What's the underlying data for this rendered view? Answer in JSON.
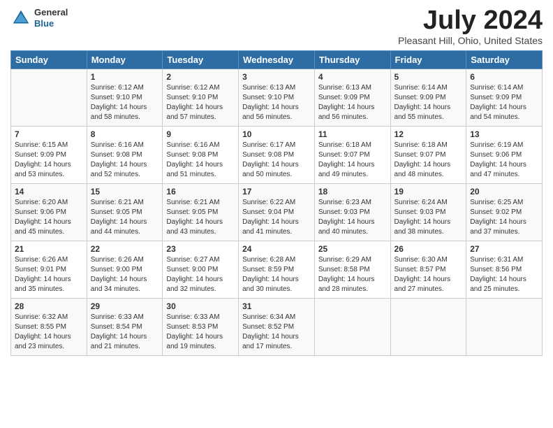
{
  "header": {
    "logo_general": "General",
    "logo_blue": "Blue",
    "month_title": "July 2024",
    "location": "Pleasant Hill, Ohio, United States"
  },
  "days_of_week": [
    "Sunday",
    "Monday",
    "Tuesday",
    "Wednesday",
    "Thursday",
    "Friday",
    "Saturday"
  ],
  "weeks": [
    [
      {
        "day": "",
        "info": ""
      },
      {
        "day": "1",
        "info": "Sunrise: 6:12 AM\nSunset: 9:10 PM\nDaylight: 14 hours\nand 58 minutes."
      },
      {
        "day": "2",
        "info": "Sunrise: 6:12 AM\nSunset: 9:10 PM\nDaylight: 14 hours\nand 57 minutes."
      },
      {
        "day": "3",
        "info": "Sunrise: 6:13 AM\nSunset: 9:10 PM\nDaylight: 14 hours\nand 56 minutes."
      },
      {
        "day": "4",
        "info": "Sunrise: 6:13 AM\nSunset: 9:09 PM\nDaylight: 14 hours\nand 56 minutes."
      },
      {
        "day": "5",
        "info": "Sunrise: 6:14 AM\nSunset: 9:09 PM\nDaylight: 14 hours\nand 55 minutes."
      },
      {
        "day": "6",
        "info": "Sunrise: 6:14 AM\nSunset: 9:09 PM\nDaylight: 14 hours\nand 54 minutes."
      }
    ],
    [
      {
        "day": "7",
        "info": "Sunrise: 6:15 AM\nSunset: 9:09 PM\nDaylight: 14 hours\nand 53 minutes."
      },
      {
        "day": "8",
        "info": "Sunrise: 6:16 AM\nSunset: 9:08 PM\nDaylight: 14 hours\nand 52 minutes."
      },
      {
        "day": "9",
        "info": "Sunrise: 6:16 AM\nSunset: 9:08 PM\nDaylight: 14 hours\nand 51 minutes."
      },
      {
        "day": "10",
        "info": "Sunrise: 6:17 AM\nSunset: 9:08 PM\nDaylight: 14 hours\nand 50 minutes."
      },
      {
        "day": "11",
        "info": "Sunrise: 6:18 AM\nSunset: 9:07 PM\nDaylight: 14 hours\nand 49 minutes."
      },
      {
        "day": "12",
        "info": "Sunrise: 6:18 AM\nSunset: 9:07 PM\nDaylight: 14 hours\nand 48 minutes."
      },
      {
        "day": "13",
        "info": "Sunrise: 6:19 AM\nSunset: 9:06 PM\nDaylight: 14 hours\nand 47 minutes."
      }
    ],
    [
      {
        "day": "14",
        "info": "Sunrise: 6:20 AM\nSunset: 9:06 PM\nDaylight: 14 hours\nand 45 minutes."
      },
      {
        "day": "15",
        "info": "Sunrise: 6:21 AM\nSunset: 9:05 PM\nDaylight: 14 hours\nand 44 minutes."
      },
      {
        "day": "16",
        "info": "Sunrise: 6:21 AM\nSunset: 9:05 PM\nDaylight: 14 hours\nand 43 minutes."
      },
      {
        "day": "17",
        "info": "Sunrise: 6:22 AM\nSunset: 9:04 PM\nDaylight: 14 hours\nand 41 minutes."
      },
      {
        "day": "18",
        "info": "Sunrise: 6:23 AM\nSunset: 9:03 PM\nDaylight: 14 hours\nand 40 minutes."
      },
      {
        "day": "19",
        "info": "Sunrise: 6:24 AM\nSunset: 9:03 PM\nDaylight: 14 hours\nand 38 minutes."
      },
      {
        "day": "20",
        "info": "Sunrise: 6:25 AM\nSunset: 9:02 PM\nDaylight: 14 hours\nand 37 minutes."
      }
    ],
    [
      {
        "day": "21",
        "info": "Sunrise: 6:26 AM\nSunset: 9:01 PM\nDaylight: 14 hours\nand 35 minutes."
      },
      {
        "day": "22",
        "info": "Sunrise: 6:26 AM\nSunset: 9:00 PM\nDaylight: 14 hours\nand 34 minutes."
      },
      {
        "day": "23",
        "info": "Sunrise: 6:27 AM\nSunset: 9:00 PM\nDaylight: 14 hours\nand 32 minutes."
      },
      {
        "day": "24",
        "info": "Sunrise: 6:28 AM\nSunset: 8:59 PM\nDaylight: 14 hours\nand 30 minutes."
      },
      {
        "day": "25",
        "info": "Sunrise: 6:29 AM\nSunset: 8:58 PM\nDaylight: 14 hours\nand 28 minutes."
      },
      {
        "day": "26",
        "info": "Sunrise: 6:30 AM\nSunset: 8:57 PM\nDaylight: 14 hours\nand 27 minutes."
      },
      {
        "day": "27",
        "info": "Sunrise: 6:31 AM\nSunset: 8:56 PM\nDaylight: 14 hours\nand 25 minutes."
      }
    ],
    [
      {
        "day": "28",
        "info": "Sunrise: 6:32 AM\nSunset: 8:55 PM\nDaylight: 14 hours\nand 23 minutes."
      },
      {
        "day": "29",
        "info": "Sunrise: 6:33 AM\nSunset: 8:54 PM\nDaylight: 14 hours\nand 21 minutes."
      },
      {
        "day": "30",
        "info": "Sunrise: 6:33 AM\nSunset: 8:53 PM\nDaylight: 14 hours\nand 19 minutes."
      },
      {
        "day": "31",
        "info": "Sunrise: 6:34 AM\nSunset: 8:52 PM\nDaylight: 14 hours\nand 17 minutes."
      },
      {
        "day": "",
        "info": ""
      },
      {
        "day": "",
        "info": ""
      },
      {
        "day": "",
        "info": ""
      }
    ]
  ]
}
